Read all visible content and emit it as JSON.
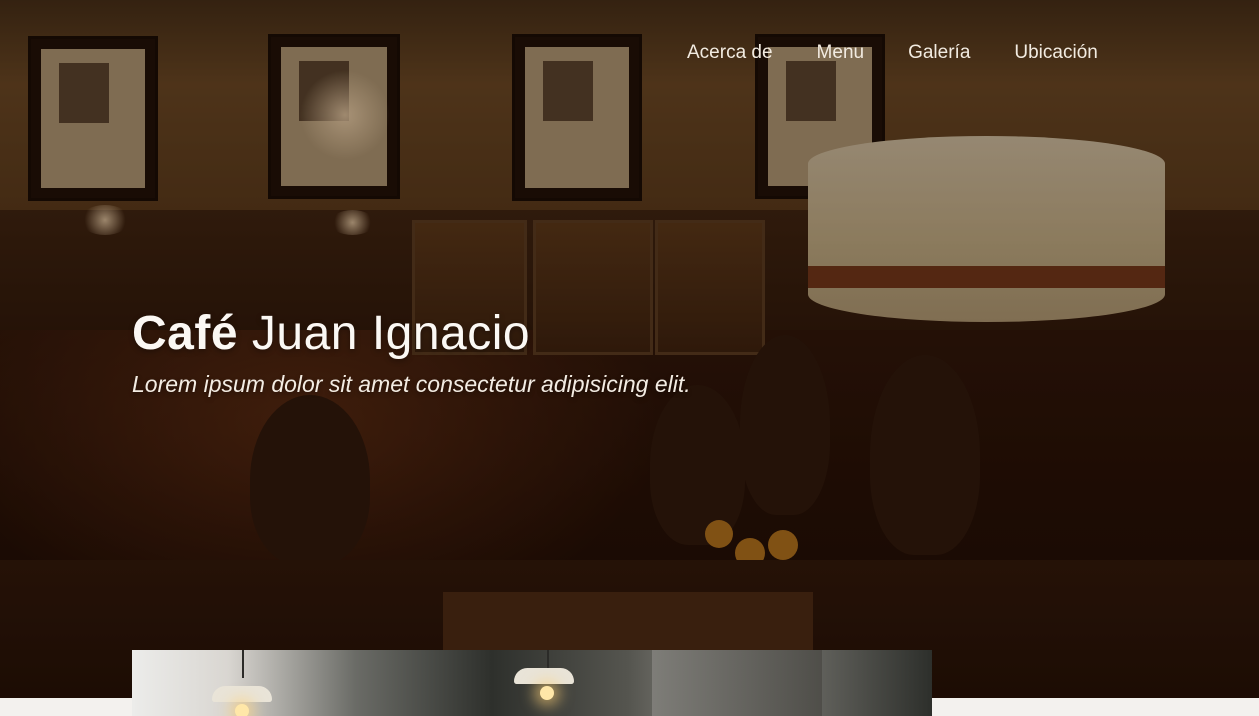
{
  "nav": {
    "items": [
      "Acerca de",
      "Menu",
      "Galería",
      "Ubicación"
    ]
  },
  "hero": {
    "title_bold": "Café",
    "title_light": "Juan Ignacio",
    "subtitle": "Lorem ipsum dolor sit amet consectetur adipisicing elit."
  },
  "colors": {
    "text": "#f2ebe1",
    "overlay": "#190a02"
  }
}
